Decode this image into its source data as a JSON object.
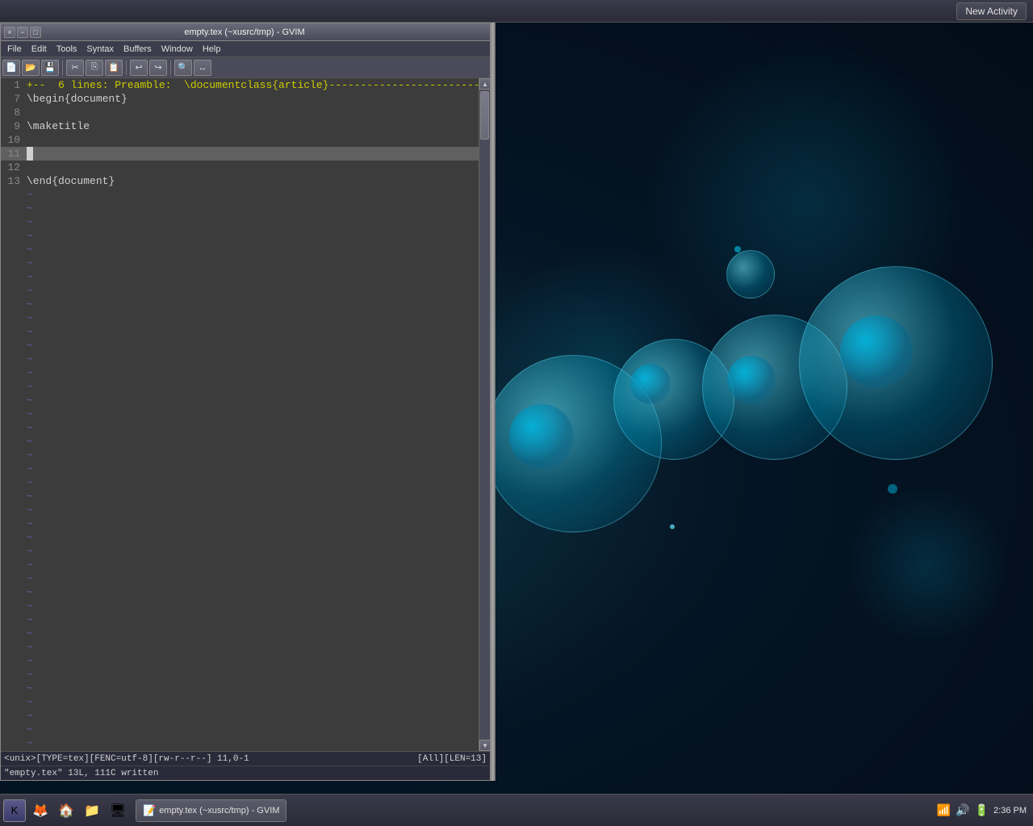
{
  "window": {
    "title": "empty.tex (~xusrc/tmp) - GVIM",
    "titlebar_text": "empty.tex (~xusrc/tmp) - GVIM"
  },
  "menu": {
    "items": [
      "File",
      "Edit",
      "Tools",
      "Syntax",
      "Buffers",
      "Window",
      "Help"
    ]
  },
  "editor": {
    "lines": [
      {
        "num": "1",
        "content": "+--  6 lines: Preamble:  \\documentclass{article}---",
        "type": "fold"
      },
      {
        "num": "7",
        "content": "\\begin{document}",
        "type": "normal"
      },
      {
        "num": "8",
        "content": "",
        "type": "normal"
      },
      {
        "num": "9",
        "content": "\\maketitle",
        "type": "normal"
      },
      {
        "num": "10",
        "content": "",
        "type": "normal"
      },
      {
        "num": "11",
        "content": "",
        "type": "current"
      },
      {
        "num": "12",
        "content": "",
        "type": "normal"
      },
      {
        "num": "13",
        "content": "\\end{document}",
        "type": "normal"
      }
    ],
    "tilde_lines": 45
  },
  "statusbar": {
    "left": "<unix>[TYPE=tex][FENC=utf-8][rw-r--r--]  11,0-1",
    "right": "[All][LEN=13]"
  },
  "cmdline": {
    "text": "\"empty.tex\" 13L, 111C written"
  },
  "taskbar": {
    "app_label": "empty.tex (~xusrc/tmp) - GVIM",
    "time": "2:36 PM",
    "date": "2:36 PM"
  },
  "top_panel": {
    "new_activity": "New Activity"
  },
  "icons": {
    "minimize": "−",
    "maximize": "□",
    "close": "×",
    "scroll_up": "▲",
    "scroll_down": "▼"
  }
}
